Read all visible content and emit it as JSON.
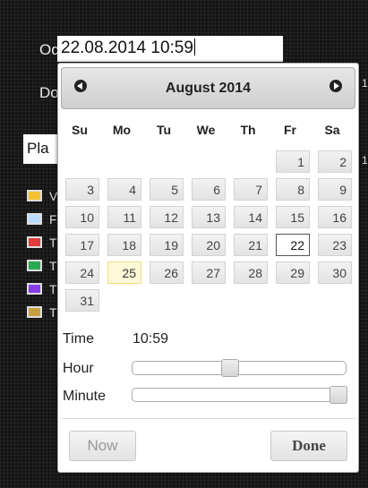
{
  "background": {
    "label_od": "Od",
    "label_do": "Do",
    "select_value": "Pla",
    "datetime_value": "22.08.2014 10:59",
    "side_numbers": [
      "1",
      "1"
    ],
    "legend": [
      {
        "letter": "V",
        "color": "#f2c230"
      },
      {
        "letter": "F",
        "color": "#b8dcff"
      },
      {
        "letter": "T",
        "color": "#e23b3b"
      },
      {
        "letter": "T",
        "color": "#28a850"
      },
      {
        "letter": "T",
        "color": "#8a3ce6"
      },
      {
        "letter": "T",
        "color": "#c8a040"
      }
    ]
  },
  "picker": {
    "month_title": "August 2014",
    "weekdays": [
      "Su",
      "Mo",
      "Tu",
      "We",
      "Th",
      "Fr",
      "Sa"
    ],
    "weeks": [
      [
        "",
        "",
        "",
        "",
        "",
        "1",
        "2"
      ],
      [
        "3",
        "4",
        "5",
        "6",
        "7",
        "8",
        "9"
      ],
      [
        "10",
        "11",
        "12",
        "13",
        "14",
        "15",
        "16"
      ],
      [
        "17",
        "18",
        "19",
        "20",
        "21",
        "22",
        "23"
      ],
      [
        "24",
        "25",
        "26",
        "27",
        "28",
        "29",
        "30"
      ],
      [
        "31",
        "",
        "",
        "",
        "",
        "",
        ""
      ]
    ],
    "today_day": "25",
    "selected_day": "22",
    "time_label": "Time",
    "time_value": "10:59",
    "hour_label": "Hour",
    "minute_label": "Minute",
    "hour_level": 0.45,
    "minute_level": 1.0,
    "now_label": "Now",
    "done_label": "Done"
  }
}
